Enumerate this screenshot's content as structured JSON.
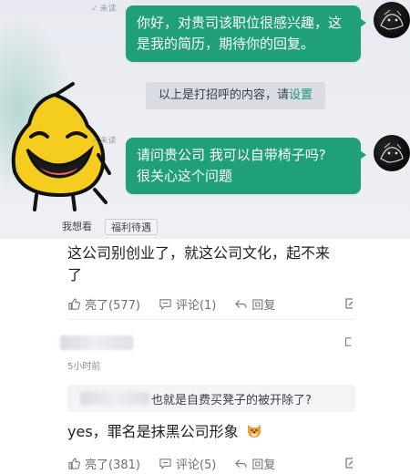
{
  "chat": {
    "unread_1": "未读",
    "message_1": [
      "你好，对贵司该职位很感兴趣，这",
      "是我的简历，期待你的回复。"
    ],
    "system_note_prefix": "以上是打招呼的内容，请",
    "system_note_link": "设置",
    "unread_2": "未读",
    "message_2": [
      "请问贵公司  我可以自带椅子吗?",
      "很关心这个问题"
    ],
    "chips": [
      "我想看",
      "福利待遇"
    ],
    "bubble_color": "#1fa078"
  },
  "comment_1": {
    "text": [
      "这公司别创业了，就这公司文化，起不来",
      "了"
    ],
    "like_label": "亮了(577)",
    "comment_label": "评论(1)",
    "reply_label": "回复"
  },
  "reply_1": {
    "time": "5小时前",
    "quote_text": "也就是自费买凳子的被开除了?",
    "text": "yes，罪名是抹黑公司形象",
    "like_label": "亮了(381)",
    "comment_label": "评论(5)",
    "reply_label": "回复"
  },
  "icons": {
    "like": "thumbs-up-icon",
    "comment": "comment-icon",
    "reply": "reply-arrow-icon",
    "share": "share-icon",
    "emoji": "dog-face-emoji-icon"
  }
}
